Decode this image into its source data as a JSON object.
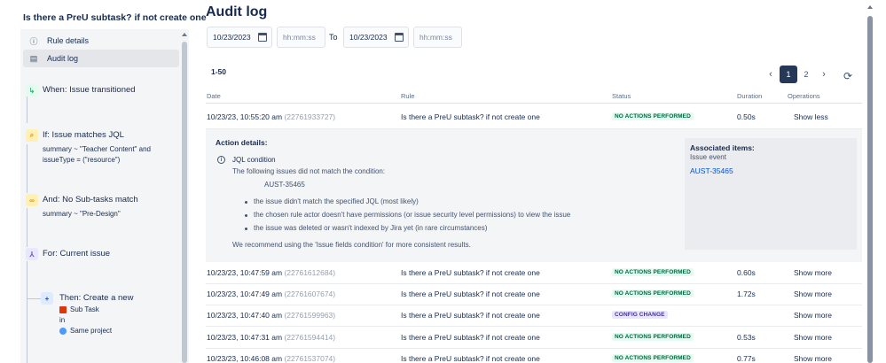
{
  "rule": {
    "title": "Is there a PreU subtask? if not create one"
  },
  "sidebar": {
    "nav": [
      {
        "label": "Rule details",
        "icon": "info-icon"
      },
      {
        "label": "Audit log",
        "icon": "document-icon"
      }
    ],
    "trigger": {
      "title": "When: Issue transitioned"
    },
    "condition1": {
      "title": "If: Issue matches JQL",
      "line1": "summary ~ \"Teacher Content\" and",
      "line2": "issueType = (\"resource\")"
    },
    "condition2": {
      "title": "And: No Sub-tasks match",
      "line1": "summary ~ \"Pre-Design\""
    },
    "branch": {
      "title": "For: Current issue"
    },
    "action": {
      "title": "Then: Create a new",
      "issue_type": "Sub Task",
      "in": "in",
      "project": "Same project"
    }
  },
  "page": {
    "title": "Audit log"
  },
  "filters": {
    "from_date": "10/23/2023",
    "from_time_placeholder": "hh:mm:ss",
    "to_label": "To",
    "to_date": "10/23/2023",
    "to_time_placeholder": "hh:mm:ss"
  },
  "pagination": {
    "range": "1-50",
    "pages": [
      "1",
      "2"
    ],
    "current": "1",
    "prev": "‹",
    "next": "›",
    "refresh": "⟳"
  },
  "table": {
    "headers": {
      "date": "Date",
      "rule": "Rule",
      "status": "Status",
      "duration": "Duration",
      "operations": "Operations"
    },
    "rows": [
      {
        "date": "10/23/23, 10:55:20 am",
        "id": "(22761933727)",
        "rule": "Is there a PreU subtask? if not create one",
        "status": "NO ACTIONS PERFORMED",
        "duration": "0.50s",
        "operation": "Show less"
      },
      {
        "date": "10/23/23, 10:47:59 am",
        "id": "(22761612684)",
        "rule": "Is there a PreU subtask? if not create one",
        "status": "NO ACTIONS PERFORMED",
        "duration": "0.60s",
        "operation": "Show more"
      },
      {
        "date": "10/23/23, 10:47:49 am",
        "id": "(22761607674)",
        "rule": "Is there a PreU subtask? if not create one",
        "status": "NO ACTIONS PERFORMED",
        "duration": "1.72s",
        "operation": "Show more"
      },
      {
        "date": "10/23/23, 10:47:40 am",
        "id": "(22761599963)",
        "rule": "Is there a PreU subtask? if not create one",
        "status": "CONFIG CHANGE",
        "duration": "",
        "operation": "Show more"
      },
      {
        "date": "10/23/23, 10:47:31 am",
        "id": "(22761594414)",
        "rule": "Is there a PreU subtask? if not create one",
        "status": "NO ACTIONS PERFORMED",
        "duration": "0.53s",
        "operation": "Show more"
      },
      {
        "date": "10/23/23, 10:46:08 am",
        "id": "(22761537074)",
        "rule": "Is there a PreU subtask? if not create one",
        "status": "NO ACTIONS PERFORMED",
        "duration": "0.77s",
        "operation": "Show more"
      }
    ]
  },
  "details": {
    "heading": "Action details:",
    "condition_title": "JQL condition",
    "condition_text": "The following issues did not match the condition:",
    "issue_key": "AUST-35465",
    "bullets": [
      "the issue didn't match the specified JQL (most likely)",
      "the chosen rule actor doesn't have permissions (or issue security level permissions) to view the issue",
      "the issue was deleted or wasn't indexed by Jira yet (in rare circumstances)"
    ],
    "recommendation": "We recommend using the 'Issue fields condition' for more consistent results.",
    "associated": {
      "title": "Associated items:",
      "subtitle": "Issue event",
      "link": "AUST-35465"
    }
  },
  "colors": {
    "accent": "#0052cc",
    "pager_active": "#253858",
    "success_bg": "#e3fcef",
    "success_fg": "#006644",
    "config_bg": "#eae6ff",
    "config_fg": "#403294"
  }
}
